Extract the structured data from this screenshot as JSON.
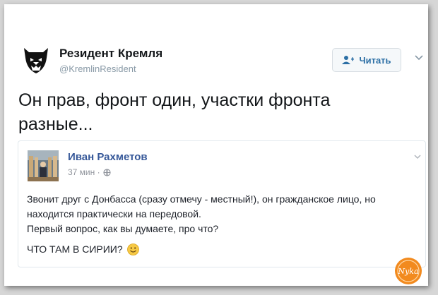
{
  "tweet": {
    "author_name": "Резидент Кремля",
    "author_handle": "@KremlinResident",
    "follow_label": "Читать",
    "text": "Он прав, фронт один, участки фронта разные..."
  },
  "quoted_post": {
    "author_name": "Иван Рахметов",
    "time_label": "37 мин ·",
    "lines": [
      "Звонит друг с Донбасса (сразу отмечу - местный!), он гражданское лицо, но находится практически на передовой.",
      "Первый вопрос, как вы думаете, про что?"
    ],
    "last_line": "ЧТО ТАМ В СИРИИ?"
  },
  "watermark_text": "Nyka",
  "colors": {
    "accent": "#2c6fa5",
    "fb_link": "#365899",
    "watermark": "#f28a1e"
  },
  "icons": [
    "bear-logo-avatar",
    "follow-user-icon",
    "chevron-down-icon",
    "globe-icon",
    "smile-emoji-icon"
  ]
}
